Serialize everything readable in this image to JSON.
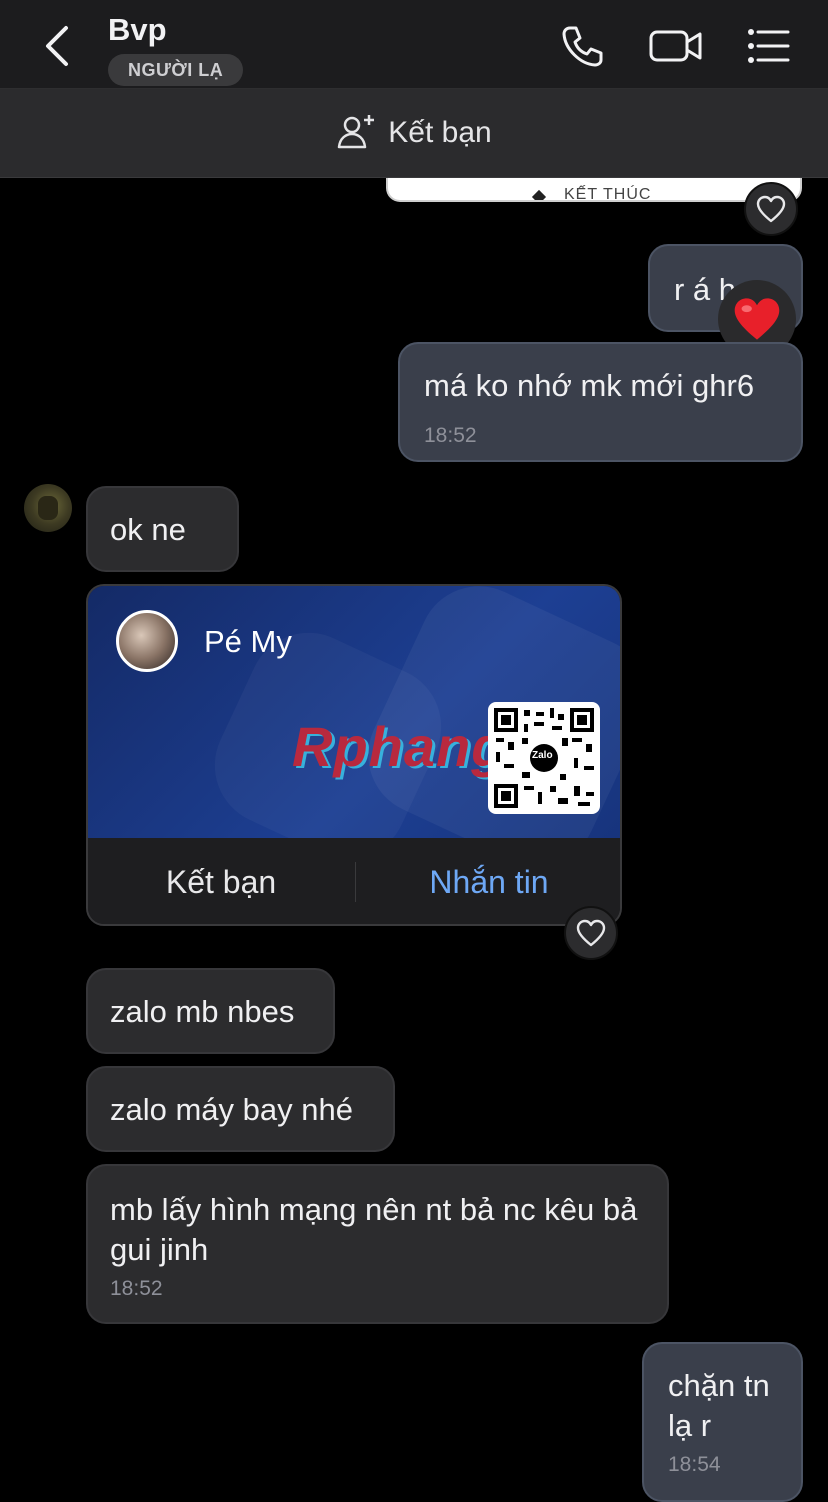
{
  "header": {
    "contact_name": "Bvp",
    "stranger_badge": "NGƯỜI LẠ",
    "icons": [
      "back-icon",
      "phone-icon",
      "video-call-icon",
      "menu-list-icon"
    ]
  },
  "friend_bar": {
    "label": "Kết bạn",
    "icon": "add-person-icon"
  },
  "messages": {
    "cut_off_image_caption": "KẾT THÚC",
    "m1": {
      "text": "r á h",
      "reaction": "heart"
    },
    "m2": {
      "text": "má ko nhớ mk mới ghr6",
      "time": "18:52"
    },
    "m3": {
      "text": "ok ne"
    },
    "card": {
      "name": "Pé My",
      "watermark": "Rphang",
      "qr_label": "Zalo",
      "add_friend": "Kết bạn",
      "message": "Nhắn tin"
    },
    "m4": {
      "text": "zalo mb nbes"
    },
    "m5": {
      "text": "zalo máy bay nhé"
    },
    "m6": {
      "text": "mb lấy hình mạng nên nt bả nc kêu bả gui jinh",
      "time": "18:52"
    },
    "m7": {
      "text": "chặn tn lạ r",
      "time": "18:54"
    }
  },
  "colors": {
    "card_blue": "#1d3f93",
    "link_blue": "#6ea8f5",
    "heart_red": "#e8202a"
  }
}
